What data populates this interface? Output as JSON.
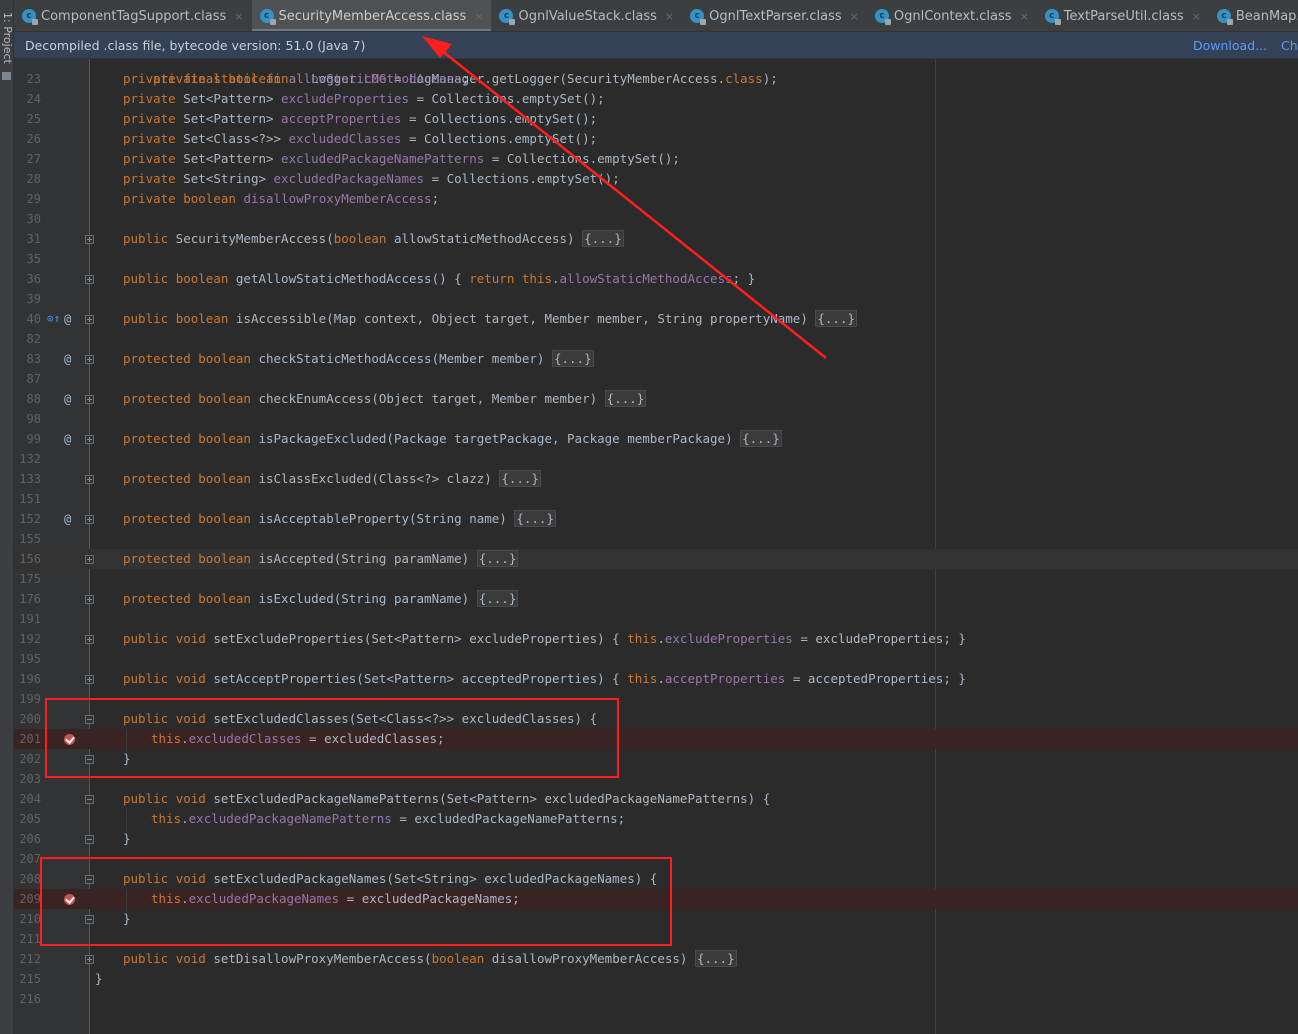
{
  "tool_window": {
    "project_label": "1: Project"
  },
  "tabs": [
    {
      "label": "ComponentTagSupport.class",
      "active": false
    },
    {
      "label": "SecurityMemberAccess.class",
      "active": true
    },
    {
      "label": "OgnlValueStack.class",
      "active": false
    },
    {
      "label": "OgnlTextParser.class",
      "active": false
    },
    {
      "label": "OgnlContext.class",
      "active": false
    },
    {
      "label": "TextParseUtil.class",
      "active": false
    },
    {
      "label": "BeanMap.class",
      "active": false
    },
    {
      "label": "Execu",
      "active": false
    }
  ],
  "tab_close_glyph": "×",
  "tab_icon_letter": "c",
  "banner": {
    "text": "Decompiled .class file, bytecode version: 51.0 (Java 7)",
    "download_link": "Download...",
    "choose_link": "Ch"
  },
  "colors": {
    "background": "#2b2b2b",
    "keyword": "#cc7832",
    "field": "#9876aa",
    "text": "#a9b7c6",
    "annotation_box": "#ff1e1e",
    "breakpoint": "#c75450"
  },
  "lines": [
    {
      "num": "23",
      "text": "private final boolean allowStaticMethodAccess;"
    },
    {
      "num": "24",
      "text": "private Set<Pattern> excludeProperties = Collections.emptySet();"
    },
    {
      "num": "25",
      "text": "private Set<Pattern> acceptProperties = Collections.emptySet();"
    },
    {
      "num": "26",
      "text": "private Set<Class<?>> excludedClasses = Collections.emptySet();"
    },
    {
      "num": "27",
      "text": "private Set<Pattern> excludedPackageNamePatterns = Collections.emptySet();"
    },
    {
      "num": "28",
      "text": "private Set<String> excludedPackageNames = Collections.emptySet();"
    },
    {
      "num": "29",
      "text": "private boolean disallowProxyMemberAccess;"
    },
    {
      "num": "30",
      "text": ""
    },
    {
      "num": "31",
      "text": "public SecurityMemberAccess(boolean allowStaticMethodAccess) {...}"
    },
    {
      "num": "35",
      "text": ""
    },
    {
      "num": "36",
      "text": "public boolean getAllowStaticMethodAccess() { return this.allowStaticMethodAccess; }"
    },
    {
      "num": "39",
      "text": ""
    },
    {
      "num": "40",
      "text": "public boolean isAccessible(Map context, Object target, Member member, String propertyName) {...}"
    },
    {
      "num": "82",
      "text": ""
    },
    {
      "num": "83",
      "text": "protected boolean checkStaticMethodAccess(Member member) {...}"
    },
    {
      "num": "87",
      "text": ""
    },
    {
      "num": "88",
      "text": "protected boolean checkEnumAccess(Object target, Member member) {...}"
    },
    {
      "num": "98",
      "text": ""
    },
    {
      "num": "99",
      "text": "protected boolean isPackageExcluded(Package targetPackage, Package memberPackage) {...}"
    },
    {
      "num": "132",
      "text": ""
    },
    {
      "num": "133",
      "text": "protected boolean isClassExcluded(Class<?> clazz) {...}"
    },
    {
      "num": "151",
      "text": ""
    },
    {
      "num": "152",
      "text": "protected boolean isAcceptableProperty(String name) {...}"
    },
    {
      "num": "155",
      "text": ""
    },
    {
      "num": "156",
      "text": "protected boolean isAccepted(String paramName) {...}"
    },
    {
      "num": "175",
      "text": ""
    },
    {
      "num": "176",
      "text": "protected boolean isExcluded(String paramName) {...}"
    },
    {
      "num": "191",
      "text": ""
    },
    {
      "num": "192",
      "text": "public void setExcludeProperties(Set<Pattern> excludeProperties) { this.excludeProperties = excludeProperties; }"
    },
    {
      "num": "195",
      "text": ""
    },
    {
      "num": "196",
      "text": "public void setAcceptProperties(Set<Pattern> acceptedProperties) { this.acceptProperties = acceptedProperties; }"
    },
    {
      "num": "199",
      "text": ""
    },
    {
      "num": "200",
      "text": "public void setExcludedClasses(Set<Class<?>> excludedClasses) {"
    },
    {
      "num": "201",
      "text": "this.excludedClasses = excludedClasses;"
    },
    {
      "num": "202",
      "text": "}"
    },
    {
      "num": "203",
      "text": ""
    },
    {
      "num": "204",
      "text": "public void setExcludedPackageNamePatterns(Set<Pattern> excludedPackageNamePatterns) {"
    },
    {
      "num": "205",
      "text": "this.excludedPackageNamePatterns = excludedPackageNamePatterns;"
    },
    {
      "num": "206",
      "text": "}"
    },
    {
      "num": "207",
      "text": ""
    },
    {
      "num": "208",
      "text": "public void setExcludedPackageNames(Set<String> excludedPackageNames) {"
    },
    {
      "num": "209",
      "text": "this.excludedPackageNames = excludedPackageNames;"
    },
    {
      "num": "210",
      "text": "}"
    },
    {
      "num": "211",
      "text": ""
    },
    {
      "num": "212",
      "text": "public void setDisallowProxyMemberAccess(boolean disallowProxyMemberAccess) {...}"
    },
    {
      "num": "215",
      "text": "}"
    },
    {
      "num": "216",
      "text": ""
    }
  ]
}
